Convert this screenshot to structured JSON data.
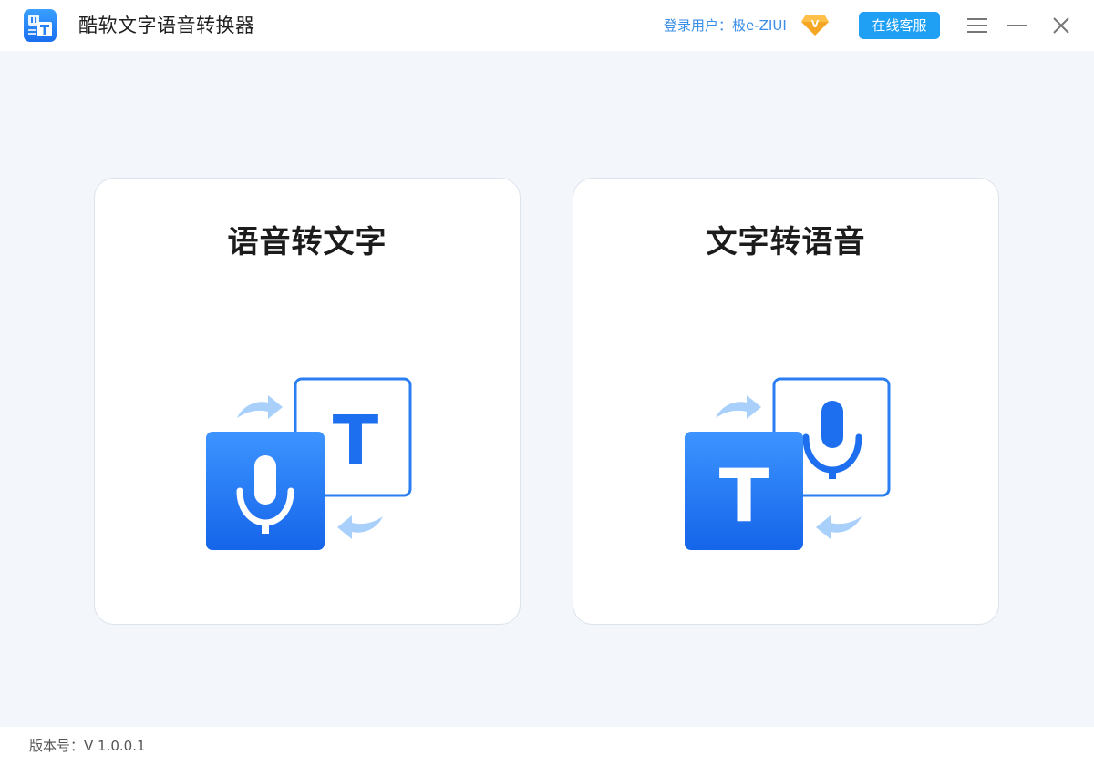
{
  "app": {
    "title": "酷软文字语音转换器"
  },
  "header": {
    "user_label": "登录用户：极e-ZIUI",
    "vip_badge_text": "V",
    "service_button": "在线客服"
  },
  "cards": [
    {
      "title": "语音转文字",
      "front_glyph": "",
      "back_glyph": "T"
    },
    {
      "title": "文字转语音",
      "front_glyph": "T",
      "back_glyph": ""
    }
  ],
  "footer": {
    "version": "版本号：V 1.0.0.1"
  },
  "icons": {
    "app_logo": "app-logo-icon",
    "vip": "diamond-icon",
    "menu": "hamburger-menu-icon",
    "minimize": "minimize-icon",
    "close": "close-icon",
    "microphone": "microphone-icon",
    "arrow": "arrow-icon"
  },
  "colors": {
    "accent": "#1fa0f5",
    "user_text": "#3a8ee6",
    "primary_blue": "#1e6ff0",
    "vip_gold": "#f5a623"
  }
}
